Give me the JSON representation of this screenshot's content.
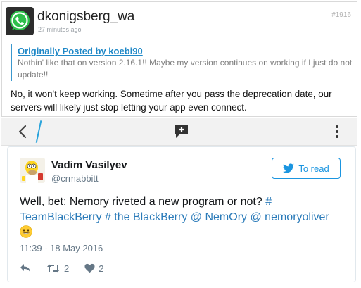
{
  "post": {
    "username": "dkonigsberg_wa",
    "timestamp": "27 minutes ago",
    "post_number": "#1916",
    "avatar_icon": "whatsapp-icon",
    "quote": {
      "author": "Originally Posted by koebi90",
      "text": "Nothin' like that on version 2.16.1!! Maybe my version continues on working if I just do not update!!"
    },
    "reply": "No, it won't keep working.  Sometime after you pass the deprecation date, our servers will likely just stop letting your app even connect."
  },
  "toolbar": {
    "back_icon": "chevron-left-icon",
    "compose_icon": "add-comment-icon",
    "more_icon": "more-vertical-icon",
    "accent_color": "#29a3db"
  },
  "tweet": {
    "name": "Vadim Vasilyev",
    "handle": "@crmabbitt",
    "follow_label": "To read",
    "text_parts": [
      "Well, bet: Nemory riveted a new program or not? ",
      "# TeamBlackBerry",
      " ",
      "# the BlackBerry",
      " ",
      "@ NemOry",
      " ",
      "@ nemoryoliver"
    ],
    "emoji": "grinning-face-emoji",
    "time": "11:39 - 18 May 2016",
    "actions": {
      "reply_icon": "reply-icon",
      "retweet_icon": "retweet-icon",
      "retweet_count": "2",
      "like_icon": "heart-icon",
      "like_count": "2"
    },
    "link_color": "#2b7bb9",
    "brand_color": "#1b95e0"
  }
}
